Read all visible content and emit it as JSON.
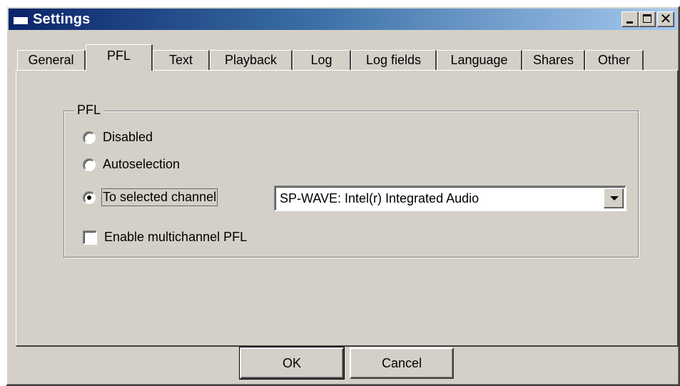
{
  "window": {
    "title": "Settings",
    "controls": [
      "minimize-icon",
      "maximize-icon",
      "close-icon"
    ],
    "close_glyph": "✕"
  },
  "tabs": [
    {
      "label": "General"
    },
    {
      "label": "PFL",
      "active": true
    },
    {
      "label": "Text"
    },
    {
      "label": "Playback"
    },
    {
      "label": "Log"
    },
    {
      "label": "Log fields"
    },
    {
      "label": "Language"
    },
    {
      "label": "Shares"
    },
    {
      "label": "Other"
    }
  ],
  "pfl": {
    "group_label": "PFL",
    "options": [
      {
        "label": "Disabled",
        "checked": false
      },
      {
        "label": "Autoselection",
        "checked": false
      },
      {
        "label": "To selected channel",
        "checked": true
      }
    ],
    "channel_select_value": "SP-WAVE: Intel(r) Integrated Audio",
    "multichannel_label": "Enable multichannel PFL",
    "multichannel_checked": false
  },
  "buttons": {
    "ok": "OK",
    "cancel": "Cancel"
  },
  "colors": {
    "face": "#d4d0c8",
    "title_start": "#0a246a",
    "title_end": "#a6caf0"
  }
}
